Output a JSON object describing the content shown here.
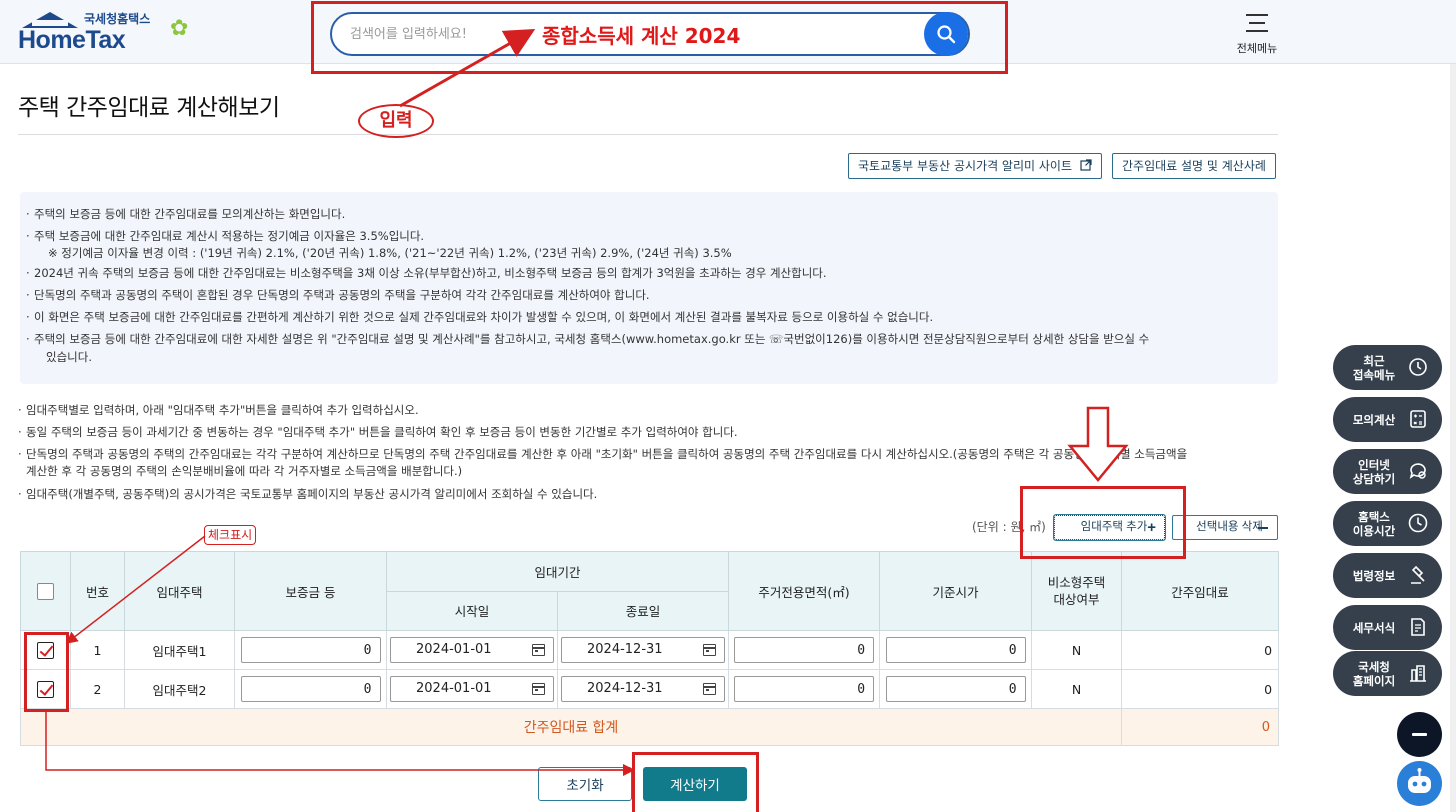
{
  "header": {
    "logo_sub": "국세청홈택스",
    "logo_main": "HomeTax",
    "search_placeholder": "검색어를 입력하세요!",
    "all_menu_label": "전체메뉴"
  },
  "annotations": {
    "search_keyword": "종합소득세 계산 2024",
    "input_label": "입력",
    "check_label": "체크표시"
  },
  "page": {
    "title": "주택 간주임대료 계산해보기",
    "link_buttons": [
      "국토교통부 부동산 공시가격 알리미 사이트",
      "간주임대료 설명 및 계산사례"
    ]
  },
  "info_items": [
    "주택의 보증금 등에 대한 간주임대료를 모의계산하는 화면입니다.",
    "주택 보증금에 대한 간주임대료 계산시 적용하는 정기예금 이자율은 3.5%입니다.",
    "※ 정기예금 이자율 변경 이력 : ('19년 귀속) 2.1%, ('20년 귀속) 1.8%, ('21~'22년 귀속) 1.2%, ('23년 귀속) 2.9%, ('24년 귀속) 3.5%",
    "2024년 귀속 주택의 보증금 등에 대한 간주임대료는 비소형주택을 3채 이상 소유(부부합산)하고, 비소형주택 보증금 등의 합계가 3억원을 초과하는 경우 계산합니다.",
    "단독명의 주택과 공동명의 주택이 혼합된 경우 단독명의 주택과 공동명의 주택을 구분하여 각각 간주임대료를 계산하여야 합니다.",
    "이 화면은 주택 보증금에 대한 간주임대료를 간편하게 계산하기 위한 것으로 실제 간주임대료와 차이가 발생할 수 있으며, 이 화면에서 계산된 결과를 불복자료 등으로 이용하실 수 없습니다.",
    "주택의 보증금 등에 대한 간주임대료에 대한 자세한 설명은 위 \"간주임대료 설명 및 계산사례\"를 참고하시고, 국세청 홈택스(www.hometax.go.kr 또는 ☏국번없이126)를 이용하시면 전문상담직원으로부터 상세한 상담을 받으실 수",
    "있습니다."
  ],
  "notes": [
    "임대주택별로 입력하며, 아래 \"임대주택 추가\"버튼을 클릭하여 추가 입력하십시오.",
    "동일 주택의 보증금 등이 과세기간 중 변동하는 경우 \"임대주택 추가\" 버튼을 클릭하여 확인 후 보증금 등이 변동한 기간별로 추가 입력하여야 합니다.",
    "단독명의 주택과 공동명의 주택의 간주임대료는 각각 구분하여 계산하므로 단독명의 주택 간주임대료를 계산한 후 아래 \"초기화\" 버튼을 클릭하여 공동명의 주택 간주임대료를 다시 계산하십시오.(공동명의 주택은 각 공동명의 주택별 소득금액을",
    "계산한 후 각 공동명의 주택의 손익분배비율에 따라 각 거주자별로 소득금액을 배분합니다.)",
    "임대주택(개별주택, 공동주택)의 공시가격은 국토교통부 홈페이지의 부동산 공시가격 알리미에서 조회하실 수 있습니다."
  ],
  "table_controls": {
    "unit": "(단위 : 원, ㎡)",
    "add_label": "임대주택 추가",
    "delete_label": "선택내용 삭제"
  },
  "table": {
    "headers": {
      "no": "번호",
      "house": "임대주택",
      "deposit": "보증금 등",
      "period": "임대기간",
      "start": "시작일",
      "end": "종료일",
      "area": "주거전용면적(㎡)",
      "price": "기준시가",
      "nonsmall": "비소형주택\n대상여부",
      "rent": "간주임대료"
    },
    "rows": [
      {
        "no": "1",
        "house": "임대주택1",
        "deposit": "0",
        "start": "2024-01-01",
        "end": "2024-12-31",
        "area": "0",
        "price": "0",
        "nonsmall": "N",
        "rent": "0",
        "checked": true
      },
      {
        "no": "2",
        "house": "임대주택2",
        "deposit": "0",
        "start": "2024-01-01",
        "end": "2024-12-31",
        "area": "0",
        "price": "0",
        "nonsmall": "N",
        "rent": "0",
        "checked": true
      }
    ],
    "total_label": "간주임대료 합계",
    "total_value": "0"
  },
  "actions": {
    "reset": "초기화",
    "calculate": "계산하기"
  },
  "side_menu": [
    {
      "label": "최근\n접속메뉴",
      "icon": "clock-icon"
    },
    {
      "label": "모의계산",
      "icon": "calculator-icon"
    },
    {
      "label": "인터넷\n상담하기",
      "icon": "chat-icon"
    },
    {
      "label": "홈택스\n이용시간",
      "icon": "time-icon"
    },
    {
      "label": "법령정보",
      "icon": "gavel-icon"
    },
    {
      "label": "세무서식",
      "icon": "document-icon"
    },
    {
      "label": "국세청\n홈페이지",
      "icon": "building-icon"
    }
  ],
  "colors": {
    "brand": "#1d4a8c",
    "accent": "#117a8b",
    "annotation": "#d42020",
    "total": "#d2591e"
  }
}
